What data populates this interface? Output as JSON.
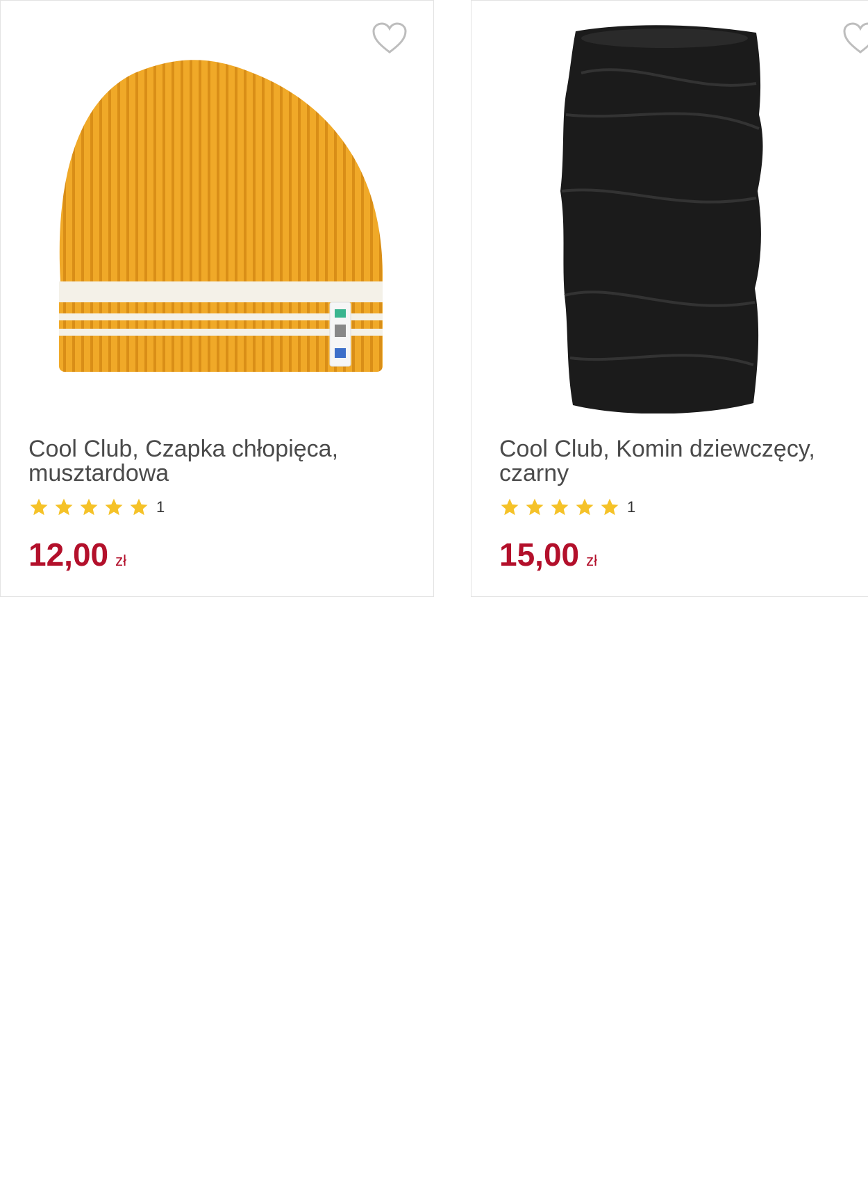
{
  "colors": {
    "price": "#b3102b",
    "star": "#f5c228",
    "title": "#4a4a4a",
    "card_border": "#e3e3e3"
  },
  "products": [
    {
      "brand_title": "Cool Club, Czapka chłopięca,",
      "title_line2": "musztardowa",
      "image_icon": "mustard-knit-beanie-image",
      "rating_stars": 5,
      "rating_count": "1",
      "price": "12,00",
      "currency": "zł"
    },
    {
      "brand_title": "Cool Club, Komin dziewczęcy,",
      "title_line2": "czarny",
      "image_icon": "black-neck-warmer-image",
      "rating_stars": 5,
      "rating_count": "1",
      "price": "15,00",
      "currency": "zł"
    }
  ]
}
